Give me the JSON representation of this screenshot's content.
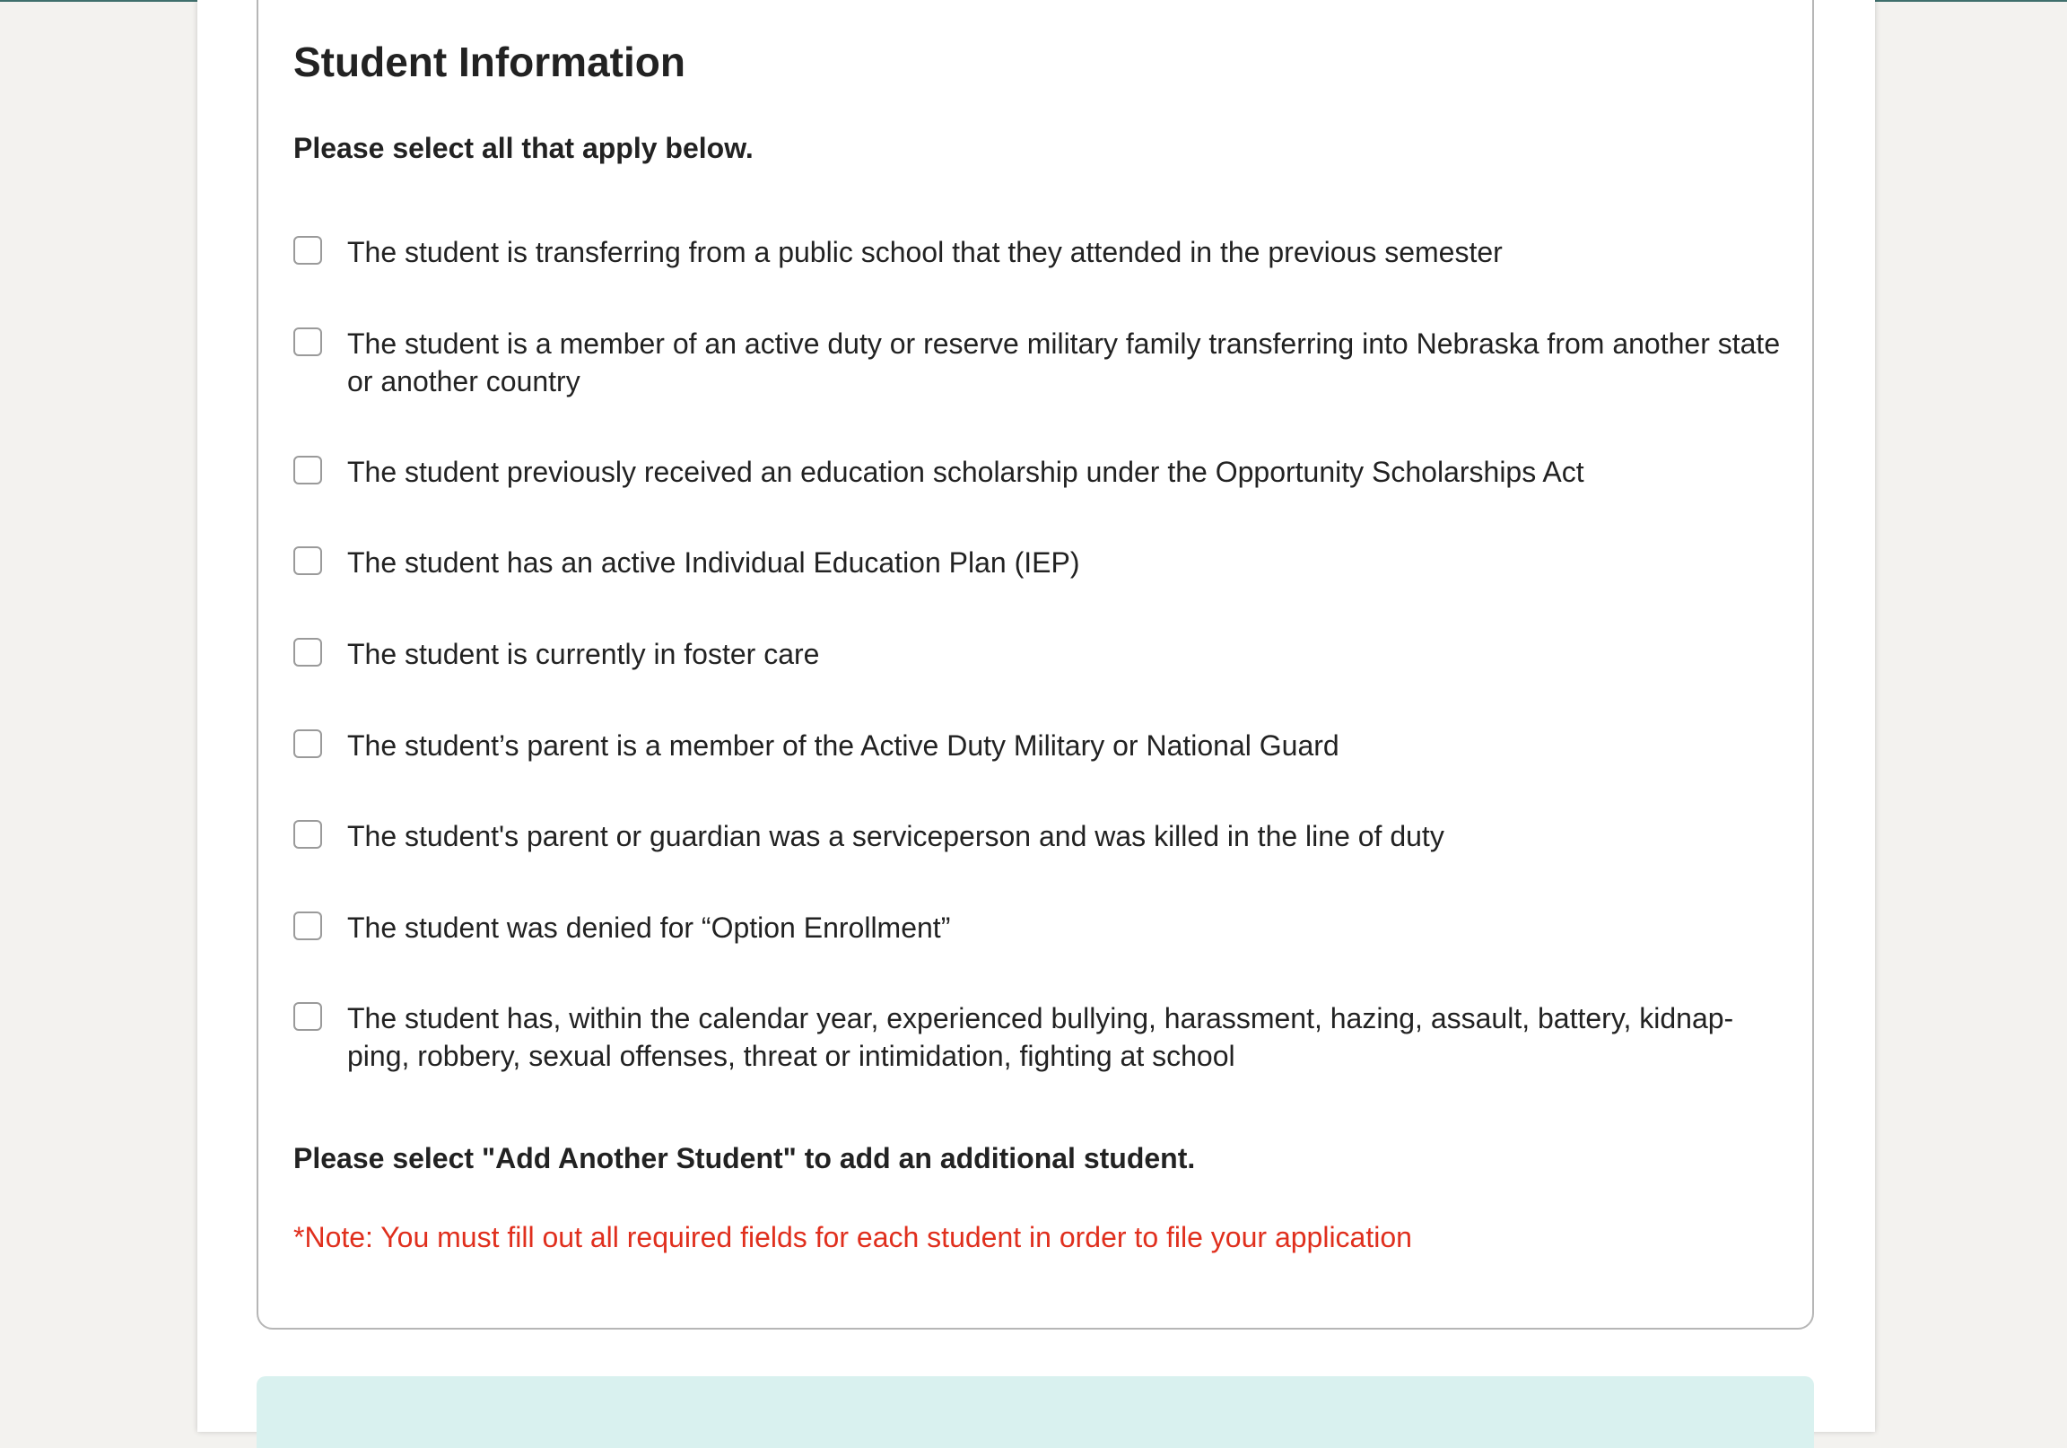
{
  "section": {
    "title": "Student Information",
    "instruction": "Please select all that apply below."
  },
  "options": [
    {
      "label": "The student is transferring from a public school that they attended in the previous semester",
      "checked": false
    },
    {
      "label": "The student is a member of an active duty or reserve military family transferring into Nebraska from another state or another country",
      "checked": false
    },
    {
      "label": "The student previously received an education scholarship under the Opportunity Scholarships Act",
      "checked": false
    },
    {
      "label": "The student has an active Individual Education Plan (IEP)",
      "checked": false
    },
    {
      "label": "The student is currently in foster care",
      "checked": false
    },
    {
      "label": "The student’s parent is a member of the Active Duty Military or National Guard",
      "checked": false
    },
    {
      "label": "The student's parent or guardian was a serviceperson and was killed in the line of duty",
      "checked": false
    },
    {
      "label": "The student was denied for “Option Enrollment”",
      "checked": false
    },
    {
      "label": "The student has, within the calendar year, experienced bullying, harassment, hazing, assault, battery, kidnap-ping, robbery, sexual offenses, threat or intimidation, fighting at school",
      "checked": false
    }
  ],
  "notes": {
    "add_student": "Please select \"Add Another Student\" to add an additional student.",
    "required": "*Note: You must fill out all required fields for each student in order to file your application"
  },
  "colors": {
    "required_note": "#e02f1d",
    "bottom_bar": "#d9f1ef",
    "top_line": "#3f6f6c"
  }
}
